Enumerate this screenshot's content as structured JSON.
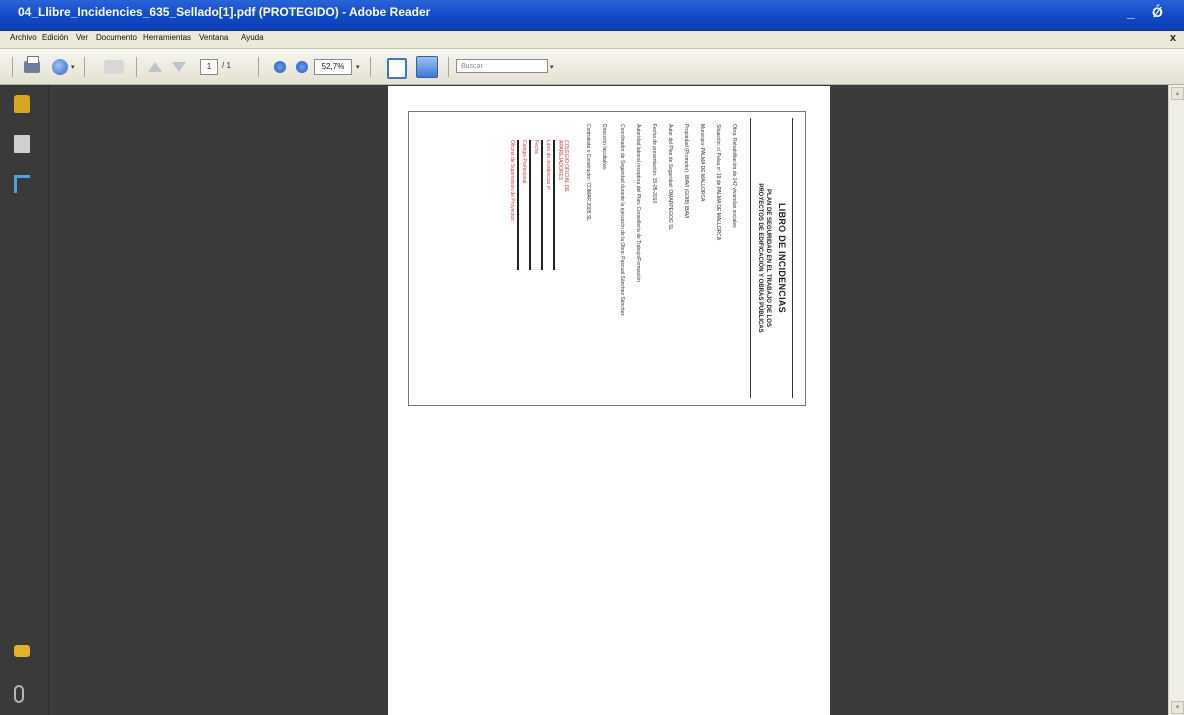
{
  "window": {
    "title": "04_Llibre_Incidencies_635_Sellado[1].pdf (PROTEGIDO) - Adobe Reader",
    "minimize_glyph": "_",
    "restore_glyph": "Ǿ"
  },
  "menu": {
    "items": [
      "Archivo",
      "Edición",
      "Ver",
      "Documento",
      "Herramientas",
      "Ventana",
      "Ayuda"
    ],
    "close_glyph": "x"
  },
  "toolbar": {
    "page_current": "1",
    "page_total": "/ 1",
    "zoom": "52,7%",
    "search_placeholder": "Buscar"
  },
  "sidebar": {
    "icons": [
      "lock-icon",
      "pages-icon",
      "bookmarks-icon",
      "comments-icon",
      "attachments-icon"
    ]
  },
  "document": {
    "title": "LIBRO DE INCIDENCIAS",
    "subtitle_1": "PLAN DE SEGURIDAD EN EL TRABAJO DE LOS",
    "subtitle_2": "PROYECTOS DE EDIFICACIÓN Y OBRAS PÚBLICAS",
    "lines": [
      "Obra: Rehabilitación de 142 viviendas sociales",
      "Situación: c/ Palau nº 19  de PALMA DE MALLORCA",
      "Municipio: PALMA DE MALLORCA",
      "Propiedad (Promotor): IBAVI (GOIB) IBAVI",
      "Autor del Plan de Seguridad: OMARPEGOG SL",
      "Fecha de presentación: 15-05-2010",
      "Autoridad laboral receptora del Plan: Consellería de Trabajo/Formación",
      "Coordinador de Seguridad durante la ejecución de la Obra: Pascual Sánchez Sánchez",
      "Dirección facultativa:",
      "Contratista o Constructor: COMAR 2005 SL"
    ],
    "stamp_lines": [
      "COLEGIO OFICIAL DE",
      "APAREJADORES",
      "Libro de incidencias nº",
      "Fecha",
      "Colegio Profesional",
      "Oficina de Supervisión de Proyectos"
    ]
  }
}
